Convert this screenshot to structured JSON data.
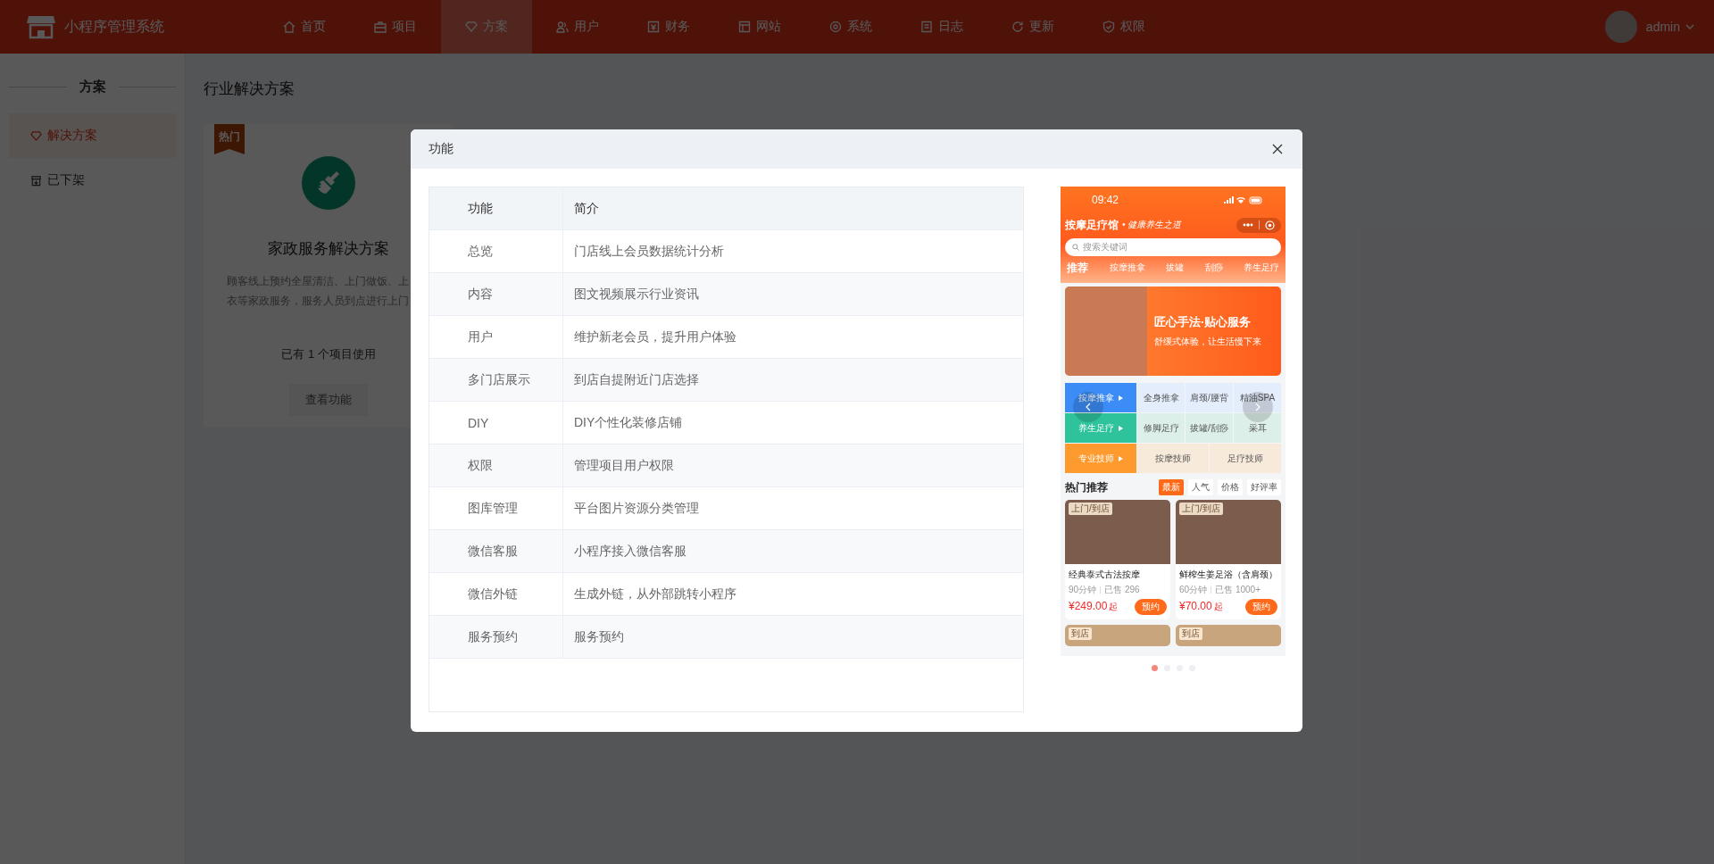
{
  "header": {
    "app_title": "小程序管理系统",
    "user": "admin",
    "nav": [
      {
        "label": "首页",
        "selected": false
      },
      {
        "label": "项目",
        "selected": false
      },
      {
        "label": "方案",
        "selected": true
      },
      {
        "label": "用户",
        "selected": false
      },
      {
        "label": "财务",
        "selected": false
      },
      {
        "label": "网站",
        "selected": false
      },
      {
        "label": "系统",
        "selected": false
      },
      {
        "label": "日志",
        "selected": false
      },
      {
        "label": "更新",
        "selected": false
      },
      {
        "label": "权限",
        "selected": false
      }
    ]
  },
  "sidebar": {
    "title": "方案",
    "items": [
      {
        "label": "解决方案",
        "selected": true
      },
      {
        "label": "已下架",
        "selected": false
      }
    ]
  },
  "page_title": "行业解决方案",
  "solution_card": {
    "badge": "热门",
    "title": "家政服务解决方案",
    "description_lines": [
      "顾客线上预约全屋清洁、上门做饭、上",
      "衣等家政服务，服务人员到点进行上门"
    ],
    "usage": "已有 1 个项目使用",
    "button": "查看功能"
  },
  "modal": {
    "title": "功能",
    "table": {
      "columns": [
        "功能",
        "简介"
      ],
      "rows": [
        [
          "总览",
          "门店线上会员数据统计分析"
        ],
        [
          "内容",
          "图文视频展示行业资讯"
        ],
        [
          "用户",
          "维护新老会员，提升用户体验"
        ],
        [
          "多门店展示",
          "到店自提附近门店选择"
        ],
        [
          "DIY",
          "DIY个性化装修店铺"
        ],
        [
          "权限",
          "管理项目用户权限"
        ],
        [
          "图库管理",
          "平台图片资源分类管理"
        ],
        [
          "微信客服",
          "小程序接入微信客服"
        ],
        [
          "微信外链",
          "生成外链，从外部跳转小程序"
        ],
        [
          "服务预约",
          "服务预约"
        ]
      ]
    },
    "preview": {
      "time": "09:42",
      "shop_name": "按摩足疗馆",
      "slogan": "• 健康养生之道",
      "search_placeholder": "搜索关键词",
      "tabs": [
        {
          "label": "推荐",
          "selected": true
        },
        {
          "label": "按摩推拿",
          "selected": false
        },
        {
          "label": "拔罐",
          "selected": false
        },
        {
          "label": "刮痧",
          "selected": false
        },
        {
          "label": "养生足疗",
          "selected": false
        }
      ],
      "banner": {
        "headline": "匠心手法·贴心服务",
        "subline": "舒缓式体验，让生活慢下来"
      },
      "category_rows": [
        {
          "title": "按摩推拿",
          "color": "#3b8cf6",
          "items": [
            "全身推拿",
            "肩颈/腰背",
            "精油SPA"
          ]
        },
        {
          "title": "养生足疗",
          "color": "#2ec39a",
          "items": [
            "修脚足疗",
            "拔罐/刮痧",
            "采耳"
          ]
        },
        {
          "title": "专业技师",
          "color": "#ff9a2e",
          "items": [
            "按摩技师",
            "足疗技师"
          ]
        }
      ],
      "hot_title": "热门推荐",
      "filters": [
        {
          "label": "最新",
          "selected": true
        },
        {
          "label": "人气",
          "selected": false
        },
        {
          "label": "价格",
          "selected": false
        },
        {
          "label": "好评率",
          "selected": false
        }
      ],
      "products": [
        {
          "tag": "上门/到店",
          "name": "经典泰式古法按摩",
          "duration": "90分钟",
          "sold": "已售 296",
          "price": "¥249.00",
          "price_suffix": "起",
          "button": "预约"
        },
        {
          "tag": "上门/到店",
          "name": "鲜榨生姜足浴（含肩颈）",
          "duration": "60分钟",
          "sold": "已售 1000+",
          "price": "¥70.00",
          "price_suffix": "起",
          "button": "预约"
        }
      ],
      "more_products": [
        {
          "tag": "到店"
        },
        {
          "tag": "到店"
        }
      ],
      "dots": [
        {
          "selected": true
        },
        {
          "selected": false
        },
        {
          "selected": false
        },
        {
          "selected": false
        }
      ]
    }
  }
}
